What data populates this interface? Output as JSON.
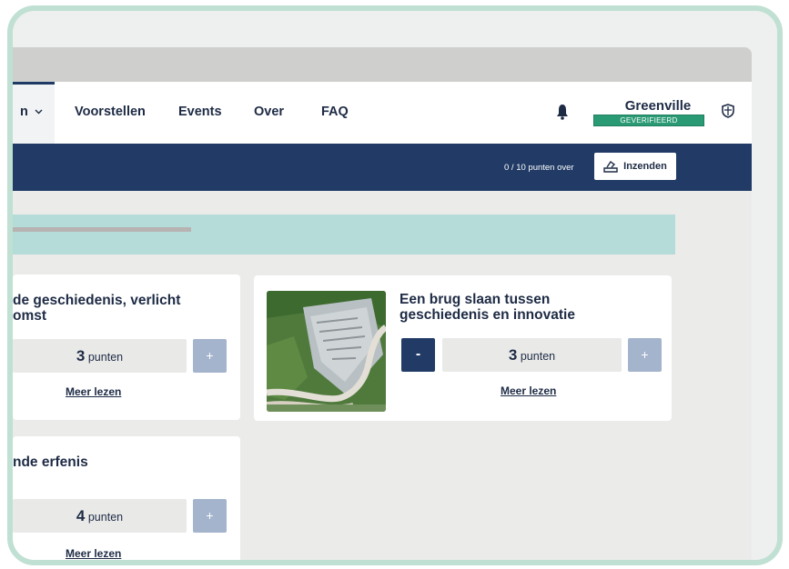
{
  "nav": {
    "partial_item": "n",
    "items": [
      "Voorstellen",
      "Events",
      "Over",
      "FAQ"
    ]
  },
  "user": {
    "name": "Greenville",
    "status": "GEVERIFIEERD"
  },
  "budget_bar": {
    "points_remaining": "0 / 10 punten over",
    "submit_label": "Inzenden"
  },
  "proposals": [
    {
      "title_line1": "de geschiedenis, verlicht",
      "title_line2": "omst",
      "points_value": "3",
      "points_unit": "punten",
      "plus": "+",
      "read_more": "Meer lezen"
    },
    {
      "title_line1": "Een brug slaan tussen",
      "title_line2": "geschiedenis en innovatie",
      "points_value": "3",
      "points_unit": "punten",
      "minus": "-",
      "plus": "+",
      "read_more": "Meer lezen"
    },
    {
      "title_line1": "nde erfenis",
      "points_value": "4",
      "points_unit": "punten",
      "plus": "+",
      "read_more": "Meer lezen"
    }
  ],
  "colors": {
    "navy": "#213b66",
    "verified_green": "#2a9a74",
    "banner_teal": "#b5dcd8",
    "frame_mint": "#bfe0d2",
    "plus_button": "#a4b4cc"
  },
  "icons": {
    "notifications": "bell-icon",
    "language": "shield-icon",
    "submit": "ballot-box-icon",
    "dropdown": "chevron-down-icon"
  }
}
